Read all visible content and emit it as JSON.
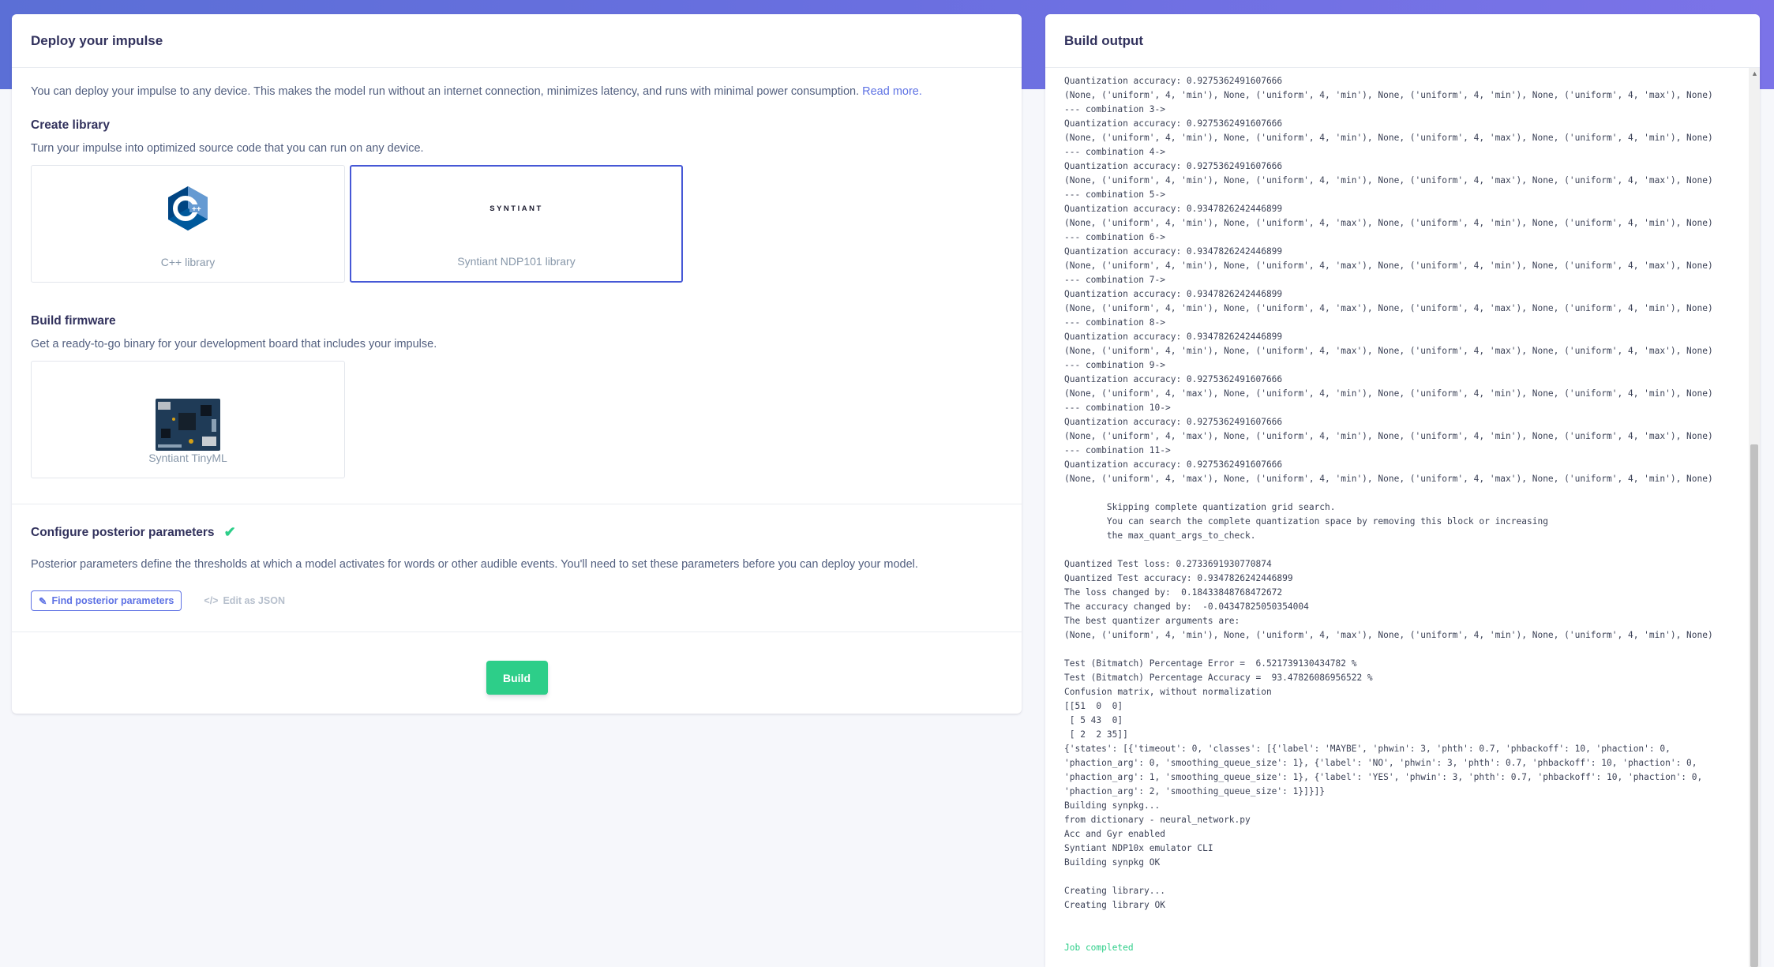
{
  "deploy": {
    "title": "Deploy your impulse",
    "intro": "You can deploy your impulse to any device. This makes the model run without an internet connection, minimizes latency, and runs with minimal power consumption.",
    "read_more": "Read more.",
    "create_library": {
      "title": "Create library",
      "subtitle": "Turn your impulse into optimized source code that you can run on any device.",
      "options": [
        {
          "label": "C++ library",
          "icon": "cpp-logo-icon"
        },
        {
          "label": "Syntiant NDP101 library",
          "logo_text": "SYNTIANT",
          "selected": true
        }
      ]
    },
    "build_firmware": {
      "title": "Build firmware",
      "subtitle": "Get a ready-to-go binary for your development board that includes your impulse.",
      "options": [
        {
          "label": "Syntiant TinyML",
          "icon": "board-image-icon"
        }
      ]
    },
    "posterior": {
      "title": "Configure posterior parameters",
      "description": "Posterior parameters define the thresholds at which a model activates for words or other audible events. You'll need to set these parameters before you can deploy your model.",
      "find_button": "Find posterior parameters",
      "edit_json": "Edit as JSON"
    },
    "build_button": "Build"
  },
  "output": {
    "title": "Build output",
    "lines": [
      "Quantization accuracy: 0.9275362491607666",
      "(None, ('uniform', 4, 'min'), None, ('uniform', 4, 'min'), None, ('uniform', 4, 'min'), None, ('uniform', 4, 'max'), None)",
      "--- combination 3->",
      "Quantization accuracy: 0.9275362491607666",
      "(None, ('uniform', 4, 'min'), None, ('uniform', 4, 'min'), None, ('uniform', 4, 'max'), None, ('uniform', 4, 'min'), None)",
      "--- combination 4->",
      "Quantization accuracy: 0.9275362491607666",
      "(None, ('uniform', 4, 'min'), None, ('uniform', 4, 'min'), None, ('uniform', 4, 'max'), None, ('uniform', 4, 'max'), None)",
      "--- combination 5->",
      "Quantization accuracy: 0.9347826242446899",
      "(None, ('uniform', 4, 'min'), None, ('uniform', 4, 'max'), None, ('uniform', 4, 'min'), None, ('uniform', 4, 'min'), None)",
      "--- combination 6->",
      "Quantization accuracy: 0.9347826242446899",
      "(None, ('uniform', 4, 'min'), None, ('uniform', 4, 'max'), None, ('uniform', 4, 'min'), None, ('uniform', 4, 'max'), None)",
      "--- combination 7->",
      "Quantization accuracy: 0.9347826242446899",
      "(None, ('uniform', 4, 'min'), None, ('uniform', 4, 'max'), None, ('uniform', 4, 'max'), None, ('uniform', 4, 'min'), None)",
      "--- combination 8->",
      "Quantization accuracy: 0.9347826242446899",
      "(None, ('uniform', 4, 'min'), None, ('uniform', 4, 'max'), None, ('uniform', 4, 'max'), None, ('uniform', 4, 'max'), None)",
      "--- combination 9->",
      "Quantization accuracy: 0.9275362491607666",
      "(None, ('uniform', 4, 'max'), None, ('uniform', 4, 'min'), None, ('uniform', 4, 'min'), None, ('uniform', 4, 'min'), None)",
      "--- combination 10->",
      "Quantization accuracy: 0.9275362491607666",
      "(None, ('uniform', 4, 'max'), None, ('uniform', 4, 'min'), None, ('uniform', 4, 'min'), None, ('uniform', 4, 'max'), None)",
      "--- combination 11->",
      "Quantization accuracy: 0.9275362491607666",
      "(None, ('uniform', 4, 'max'), None, ('uniform', 4, 'min'), None, ('uniform', 4, 'max'), None, ('uniform', 4, 'min'), None)",
      "",
      "        Skipping complete quantization grid search.",
      "        You can search the complete quantization space by removing this block or increasing",
      "        the max_quant_args_to_check.",
      "",
      "Quantized Test loss: 0.2733691930770874",
      "Quantized Test accuracy: 0.9347826242446899",
      "The loss changed by:  0.18433848768472672",
      "The accuracy changed by:  -0.04347825050354004",
      "The best quantizer arguments are:",
      "(None, ('uniform', 4, 'min'), None, ('uniform', 4, 'max'), None, ('uniform', 4, 'min'), None, ('uniform', 4, 'min'), None)",
      "",
      "Test (Bitmatch) Percentage Error =  6.521739130434782 %",
      "Test (Bitmatch) Percentage Accuracy =  93.47826086956522 %",
      "Confusion matrix, without normalization",
      "[[51  0  0]",
      " [ 5 43  0]",
      " [ 2  2 35]]",
      "{'states': [{'timeout': 0, 'classes': [{'label': 'MAYBE', 'phwin': 3, 'phth': 0.7, 'phbackoff': 10, 'phaction': 0,",
      "'phaction_arg': 0, 'smoothing_queue_size': 1}, {'label': 'NO', 'phwin': 3, 'phth': 0.7, 'phbackoff': 10, 'phaction': 0,",
      "'phaction_arg': 1, 'smoothing_queue_size': 1}, {'label': 'YES', 'phwin': 3, 'phth': 0.7, 'phbackoff': 10, 'phaction': 0,",
      "'phaction_arg': 2, 'smoothing_queue_size': 1}]}]}",
      "Building synpkg...",
      "from dictionary - neural_network.py",
      "Acc and Gyr enabled",
      "Syntiant NDP10x emulator CLI",
      "Building synpkg OK",
      "",
      "Creating library...",
      "Creating library OK",
      "",
      ""
    ],
    "done": "Job completed"
  },
  "colors": {
    "accent": "#5e72e4",
    "success": "#2dce89",
    "selected_border": "#4658d6"
  }
}
